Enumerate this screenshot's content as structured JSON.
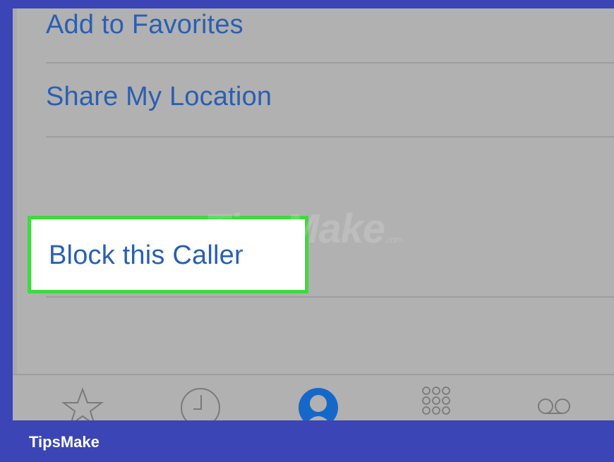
{
  "menu": {
    "add_favorites": "Add to Favorites",
    "share_location": "Share My Location",
    "block_caller": "Block this Caller"
  },
  "watermark": {
    "text": "TipsMake",
    "suffix": ".com"
  },
  "tabbar": {
    "tabs": [
      {
        "icon": "star-icon"
      },
      {
        "icon": "clock-icon"
      },
      {
        "icon": "contacts-icon",
        "active": true
      },
      {
        "icon": "keypad-icon"
      },
      {
        "icon": "voicemail-icon"
      }
    ]
  },
  "footer": {
    "label": "TipsMake"
  },
  "colors": {
    "link_blue": "#2a5fb3",
    "highlight_border": "#3ddb3d",
    "frame": "#3b45b5",
    "screen_bg": "#b1b1b1"
  }
}
